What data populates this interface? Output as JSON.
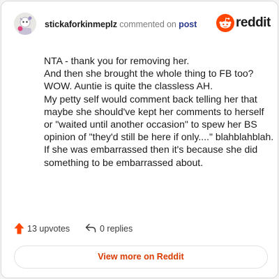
{
  "header": {
    "username": "stickaforkinmeplz",
    "action_text": "commented on",
    "link_text": "post",
    "brand": "reddit",
    "avatar_icon": "snoo-avatar-icon",
    "brand_icon": "reddit-logo-icon"
  },
  "comment": {
    "lines": [
      "NTA - thank you for removing her.",
      "And then she brought the whole thing to FB too? WOW. Auntie is quite the classless AH.",
      "My petty self would comment back telling her that maybe she should've kept her comments to herself or \"waited until another occasion\" to spew her BS opinion of \"they'd still be here if only....\" blahblahblah.",
      "If she was embarrassed then it's because she did something to be embarrassed about."
    ]
  },
  "actions": {
    "upvotes_label": "13 upvotes",
    "replies_label": "0 replies",
    "upvote_icon": "upvote-arrow-icon",
    "reply_icon": "reply-icon"
  },
  "footer": {
    "view_more_label": "View more on Reddit"
  },
  "colors": {
    "accent": "#ff4500",
    "link": "#2a3a8c",
    "view_more": "#d93a00"
  }
}
